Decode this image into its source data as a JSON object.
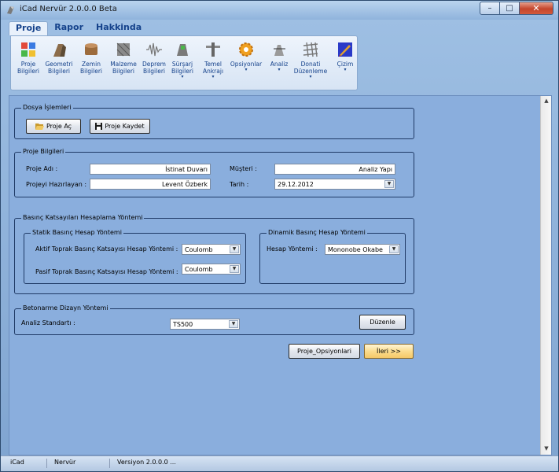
{
  "window": {
    "title": "iCad Nervür 2.0.0.0 Beta",
    "min": "–",
    "max": "□",
    "close": "✕"
  },
  "ribbon": {
    "tabs": [
      "Proje",
      "Rapor",
      "Hakkinda"
    ],
    "buttons": [
      {
        "label": "Proje\nBilgileri",
        "icon": "project-info-icon",
        "dropdown": false
      },
      {
        "label": "Geometri\nBilgileri",
        "icon": "geometry-icon",
        "dropdown": false
      },
      {
        "label": "Zemin\nBilgileri",
        "icon": "soil-icon",
        "dropdown": false
      },
      {
        "label": "Malzeme\nBilgileri",
        "icon": "material-icon",
        "dropdown": false
      },
      {
        "label": "Deprem\nBilgileri",
        "icon": "earthquake-icon",
        "dropdown": false
      },
      {
        "label": "Sürşarj\nBilgileri",
        "icon": "surcharge-icon",
        "dropdown": true
      },
      {
        "label": "Temel\nAnkrajı",
        "icon": "foundation-anchor-icon",
        "dropdown": true
      },
      {
        "label": "Opsiyonlar",
        "icon": "options-gear-icon",
        "dropdown": true
      },
      {
        "label": "Analiz",
        "icon": "analysis-icon",
        "dropdown": true
      },
      {
        "label": "Donati\nDüzenleme",
        "icon": "reinforcement-icon",
        "dropdown": true
      },
      {
        "label": "Çizim",
        "icon": "drawing-icon",
        "dropdown": true
      }
    ]
  },
  "file_ops": {
    "title": "Dosya İşlemleri",
    "open": "Proje Aç",
    "save": "Proje Kaydet"
  },
  "project_info": {
    "title": "Proje Bilgileri",
    "name_label": "Proje Adı :",
    "name_value": "İstinat Duvarı",
    "client_label": "Müşteri :",
    "client_value": "Analiz Yapı",
    "preparer_label": "Projeyi Hazırlayan :",
    "preparer_value": "Levent Özberk",
    "date_label": "Tarih :",
    "date_value": "29.12.2012"
  },
  "pressure": {
    "title": "Basınç Katsayıları Hesaplama Yöntemi",
    "static_title": "Statik Basınç Hesap Yöntemi",
    "active_label": "Aktif Toprak Basınç Katsayısı Hesap Yöntemi :",
    "active_value": "Coulomb",
    "passive_label": "Pasif Toprak Basınç Katsayısı Hesap Yöntemi :",
    "passive_value": "Coulomb",
    "dynamic_title": "Dinamik Basınç Hesap Yöntemi",
    "method_label": "Hesap Yöntemi :",
    "method_value": "Mononobe Okabe"
  },
  "concrete": {
    "title": "Betonarme Dizayn Yöntemi",
    "standard_label": "Analiz Standartı :",
    "standard_value": "TS500",
    "edit_button": "Düzenle"
  },
  "footer_buttons": {
    "options": "Proje_Opsiyonlari",
    "next": "İleri >>"
  },
  "statusbar": {
    "app": "iCad",
    "module": "Nervür",
    "version": "Versiyon 2.0.0.0 ..."
  },
  "colors": {
    "panel": "#8aaedd",
    "ribbon_text": "#15428b",
    "next_button": "#f5c868"
  }
}
